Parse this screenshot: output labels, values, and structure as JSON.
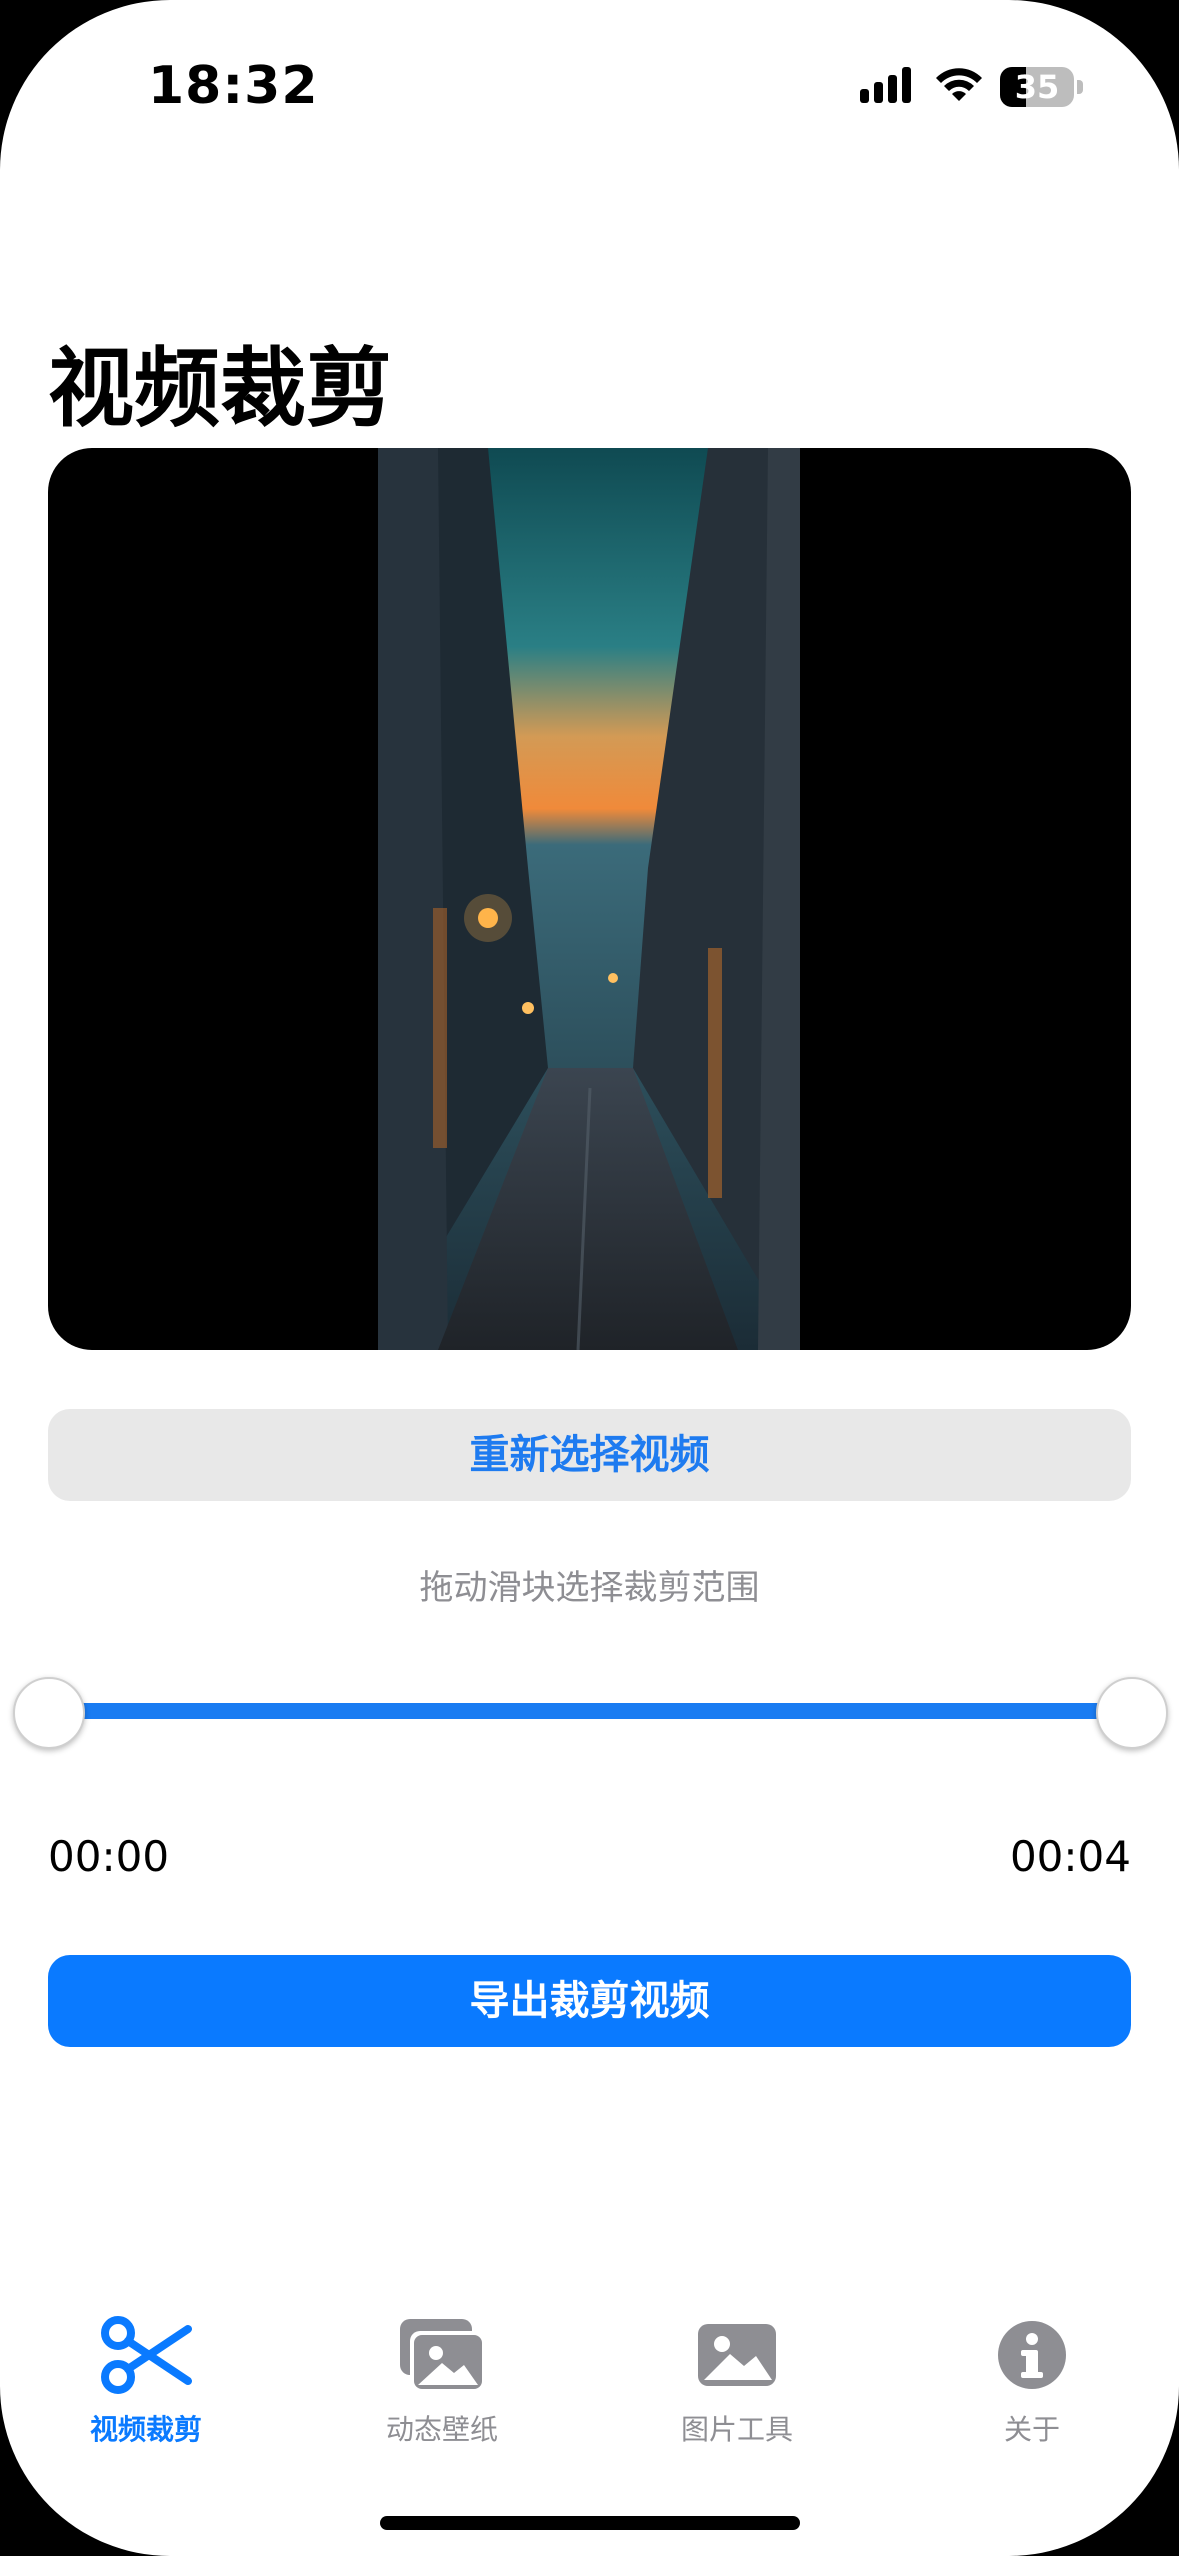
{
  "status_bar": {
    "time": "18:32",
    "battery_percent": "35",
    "battery_level": 0.35,
    "icons": [
      "signal-icon",
      "wifi-icon",
      "battery-icon"
    ]
  },
  "page": {
    "title": "视频裁剪"
  },
  "video": {
    "thumbnail": "night-street-video-thumbnail"
  },
  "actions": {
    "reselect_label": "重新选择视频",
    "export_label": "导出裁剪视频"
  },
  "trim": {
    "hint": "拖动滑块选择裁剪范围",
    "start_time": "00:00",
    "end_time": "00:04",
    "range": [
      0,
      1
    ]
  },
  "tabbar": {
    "tabs": [
      {
        "label": "视频裁剪",
        "icon": "scissors-icon",
        "active": true
      },
      {
        "label": "动态壁纸",
        "icon": "photo-stack-icon",
        "active": false
      },
      {
        "label": "图片工具",
        "icon": "photo-icon",
        "active": false
      },
      {
        "label": "关于",
        "icon": "info-icon",
        "active": false
      }
    ]
  },
  "colors": {
    "accent": "#0a7aff",
    "secondary_text": "#8e8e93",
    "button_gray": "#e8e8e8"
  }
}
